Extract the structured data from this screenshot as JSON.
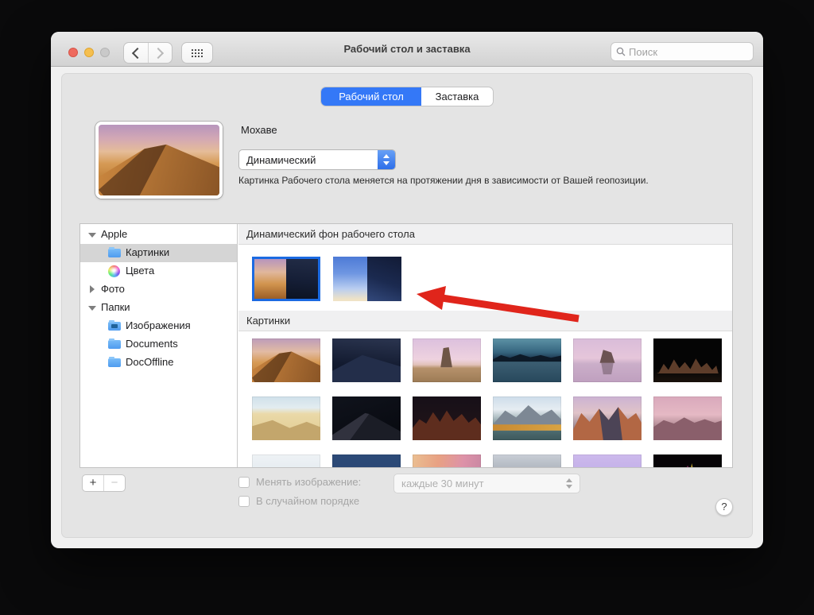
{
  "titlebar": {
    "title": "Рабочий стол и заставка",
    "search_placeholder": "Поиск"
  },
  "tabs": {
    "desktop": "Рабочий стол",
    "screensaver": "Заставка"
  },
  "selection": {
    "name": "Мохаве",
    "style": "Динамический",
    "description": "Картинка Рабочего стола меняется на протяжении дня в зависимости от Вашей геопозиции."
  },
  "sidebar": {
    "apple_group": "Apple",
    "pictures": "Картинки",
    "colors": "Цвета",
    "photos_group": "Фото",
    "folders_group": "Папки",
    "images_folder": "Изображения",
    "documents_folder": "Documents",
    "docoffline_folder": "DocOffline"
  },
  "main": {
    "dynamic_header": "Динамический фон рабочего стола",
    "pictures_header": "Картинки"
  },
  "footer": {
    "add": "+",
    "remove": "−",
    "change_label": "Менять изображение:",
    "interval": "каждые 30 минут",
    "random_label": "В случайном порядке",
    "help": "?"
  },
  "colors": {
    "accent_blue": "#3478f7",
    "selection_border": "#1b6ae2",
    "arrow_red": "#e0251b",
    "folder_blue": "#58a7f2"
  }
}
